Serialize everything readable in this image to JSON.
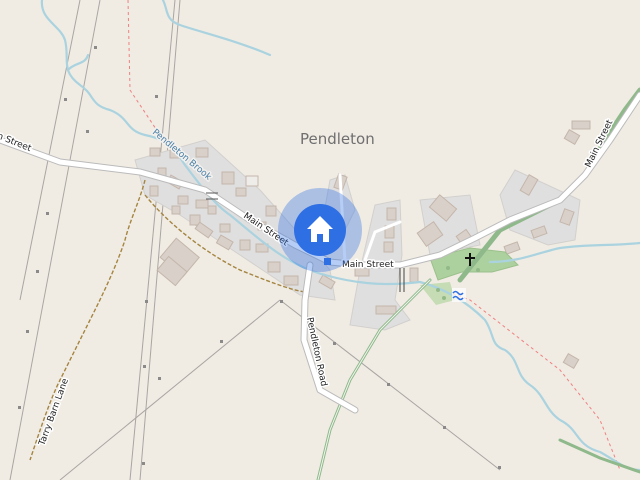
{
  "map": {
    "place_label": "Pendleton",
    "roads": {
      "main_street_1": "Main Street",
      "main_street_2": "Main Street",
      "main_street_3": "Main Street",
      "main_street_4": "Main Street",
      "pendleton_road": "Pendleton Road",
      "tarry_barn_lane": "Tarry Barn Lane"
    },
    "waterways": {
      "brook": "Pendleton Brook"
    },
    "markers": {
      "current_location_icon": "home-icon",
      "poi_square_icon": "square-marker-icon",
      "church_icon": "cross-icon",
      "water_icon": "waves-icon"
    },
    "colors": {
      "background": "#f0ece4",
      "residential": "#e0dfdf",
      "building": "#d9d0c9",
      "water": "#aad3df",
      "green": "#add19e",
      "road_casing": "#bbbbbb",
      "road": "#ffffff",
      "path_green": "#8fb98b",
      "track_brown": "#a58541",
      "boundary": "#9e9e9e",
      "dashed_red": "#f08080",
      "location_accent": "#2f6fe4"
    }
  }
}
